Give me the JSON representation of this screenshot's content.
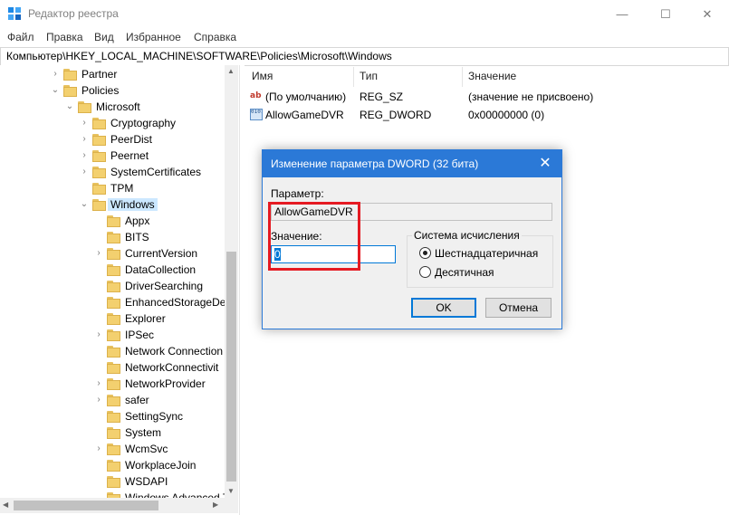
{
  "window": {
    "title": "Редактор реестра",
    "minimize": "—",
    "maximize": "☐",
    "close": "✕"
  },
  "menu": [
    "Файл",
    "Правка",
    "Вид",
    "Избранное",
    "Справка"
  ],
  "address": "Компьютер\\HKEY_LOCAL_MACHINE\\SOFTWARE\\Policies\\Microsoft\\Windows",
  "tree": [
    {
      "label": "Partner",
      "chevron": "›",
      "selected": false
    },
    {
      "label": "Policies",
      "chevron": "⌄",
      "selected": false
    },
    {
      "label": "Microsoft",
      "chevron": "⌄",
      "selected": false
    },
    {
      "label": "Cryptography",
      "chevron": "›",
      "selected": false
    },
    {
      "label": "PeerDist",
      "chevron": "›",
      "selected": false
    },
    {
      "label": "Peernet",
      "chevron": "›",
      "selected": false
    },
    {
      "label": "SystemCertificates",
      "chevron": "›",
      "selected": false
    },
    {
      "label": "TPM",
      "chevron": "",
      "selected": false
    },
    {
      "label": "Windows",
      "chevron": "⌄",
      "selected": true
    },
    {
      "label": "Appx",
      "chevron": "",
      "selected": false
    },
    {
      "label": "BITS",
      "chevron": "",
      "selected": false
    },
    {
      "label": "CurrentVersion",
      "chevron": "›",
      "selected": false
    },
    {
      "label": "DataCollection",
      "chevron": "",
      "selected": false
    },
    {
      "label": "DriverSearching",
      "chevron": "",
      "selected": false
    },
    {
      "label": "EnhancedStorageDe",
      "chevron": "",
      "selected": false
    },
    {
      "label": "Explorer",
      "chevron": "",
      "selected": false
    },
    {
      "label": "IPSec",
      "chevron": "›",
      "selected": false
    },
    {
      "label": "Network Connection",
      "chevron": "",
      "selected": false
    },
    {
      "label": "NetworkConnectivit",
      "chevron": "",
      "selected": false
    },
    {
      "label": "NetworkProvider",
      "chevron": "›",
      "selected": false
    },
    {
      "label": "safer",
      "chevron": "›",
      "selected": false
    },
    {
      "label": "SettingSync",
      "chevron": "",
      "selected": false
    },
    {
      "label": "System",
      "chevron": "",
      "selected": false
    },
    {
      "label": "WcmSvc",
      "chevron": "›",
      "selected": false
    },
    {
      "label": "WorkplaceJoin",
      "chevron": "",
      "selected": false
    },
    {
      "label": "WSDAPI",
      "chevron": "",
      "selected": false
    },
    {
      "label": "Windows Advanced Th",
      "chevron": "",
      "selected": false
    }
  ],
  "tree_scroll": {
    "up": "▲",
    "down": "▼",
    "left": "◀",
    "right": "▶"
  },
  "values_pane": {
    "columns": [
      "Имя",
      "Тип",
      "Значение"
    ],
    "rows": [
      {
        "icon": "string-value-icon",
        "icon_text": "ab",
        "name": "(По умолчанию)",
        "type": "REG_SZ",
        "data": "(значение не присвоено)"
      },
      {
        "icon": "binary-value-icon",
        "icon_text": "010110",
        "name": "AllowGameDVR",
        "type": "REG_DWORD",
        "data": "0x00000000 (0)"
      }
    ]
  },
  "dialog": {
    "title": "Изменение параметра DWORD (32 бита)",
    "close": "✕",
    "param_label": "Параметр:",
    "param_value": "AllowGameDVR",
    "value_label": "Значение:",
    "value_value": "0",
    "radix_group": "Система исчисления",
    "radix_hex": "Шестнадцатеричная",
    "radix_dec": "Десятичная",
    "radix_selected": "hex",
    "ok": "OK",
    "cancel": "Отмена"
  },
  "colors": {
    "accent": "#2b79d7",
    "highlight": "#e51a22",
    "selection": "#cce8ff"
  }
}
